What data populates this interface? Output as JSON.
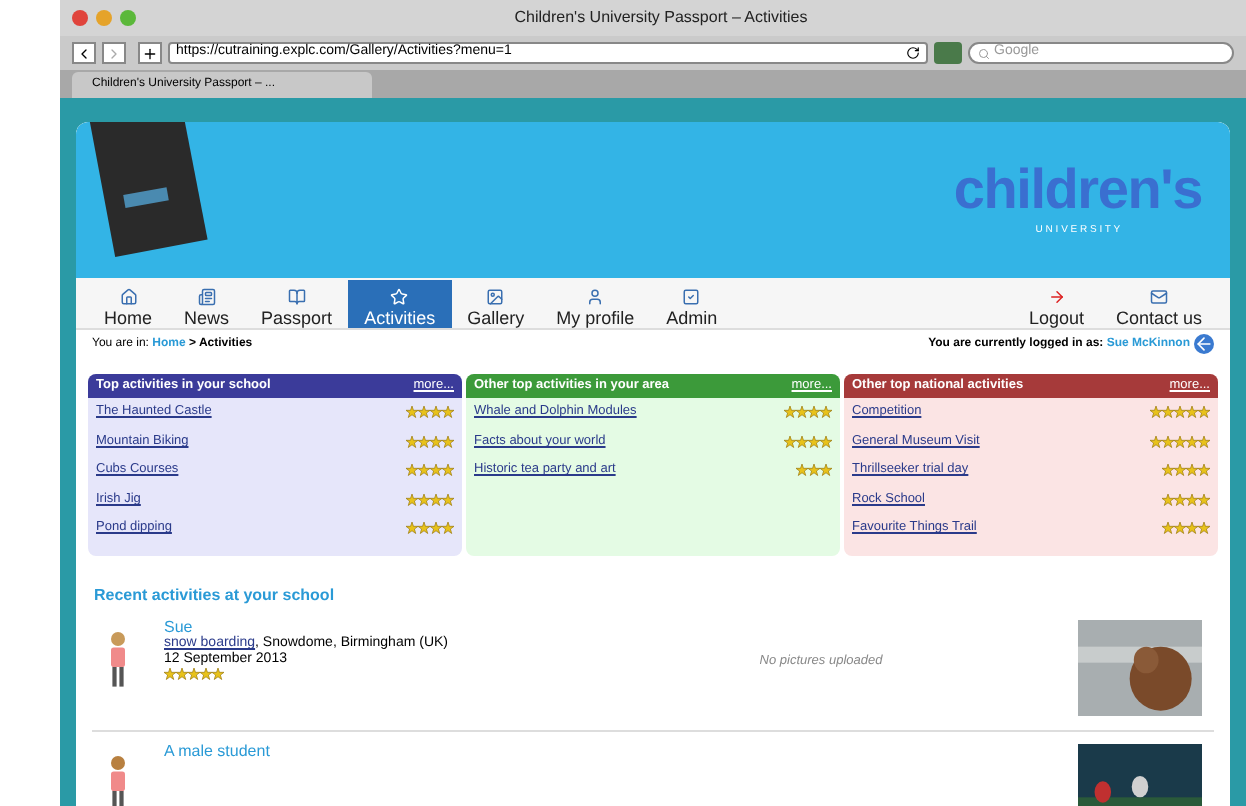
{
  "window": {
    "title": "Children's University Passport – Activities"
  },
  "toolbar": {
    "url": "https://cutraining.explc.com/Gallery/Activities?menu=1",
    "search_placeholder": "Google"
  },
  "tabs": [
    {
      "label": "Children's University Passport – ...",
      "selected": true
    }
  ],
  "logo": {
    "word": "children's",
    "subtitle": "U N I V E R S I T Y"
  },
  "nav": [
    {
      "label": "Home",
      "selected": false
    },
    {
      "label": "News",
      "selected": false
    },
    {
      "label": "Passport",
      "selected": false
    },
    {
      "label": "Activities",
      "selected": true
    },
    {
      "label": "Gallery",
      "selected": false
    },
    {
      "label": "My profile",
      "selected": false
    },
    {
      "label": "Admin",
      "selected": false
    }
  ],
  "nav_right": [
    {
      "label": "Logout",
      "selected": false
    },
    {
      "label": "Contact us",
      "selected": false
    }
  ],
  "breadcrumb": {
    "prefix": "You are in:",
    "home": "Home",
    "separator": ">",
    "current": "Activities"
  },
  "login": {
    "prefix": "You are currently logged in as:",
    "user": "Sue McKinnon"
  },
  "panels": [
    {
      "title": "Top activities in your school",
      "more": "more...",
      "color": "#3b3b9a",
      "items": [
        {
          "name": "The Haunted Castle",
          "stars": 4
        },
        {
          "name": "Mountain Biking",
          "stars": 4
        },
        {
          "name": "Cubs Courses",
          "stars": 4
        },
        {
          "name": "Irish Jig",
          "stars": 4
        },
        {
          "name": "Pond dipping",
          "stars": 4
        }
      ]
    },
    {
      "title": "Other top activities in your area",
      "more": "more...",
      "color": "#3c9a3a",
      "items": [
        {
          "name": "Whale and Dolphin Modules",
          "stars": 4
        },
        {
          "name": "Facts about your world",
          "stars": 4
        },
        {
          "name": "Historic tea party and art",
          "stars": 3
        }
      ]
    },
    {
      "title": "Other top national activities",
      "more": "more...",
      "color": "#a63a3a",
      "items": [
        {
          "name": "Competition",
          "stars": 5
        },
        {
          "name": "General Museum Visit",
          "stars": 5
        },
        {
          "name": "Thrillseeker trial day",
          "stars": 4
        },
        {
          "name": "Rock School",
          "stars": 4
        },
        {
          "name": "Favourite Things Trail",
          "stars": 4
        }
      ]
    }
  ],
  "recent": {
    "heading": "Recent activities at your school",
    "entries": [
      {
        "name": "Sue",
        "activity": "snow boarding",
        "place": ", Snowdome, Birmingham (UK)",
        "date": "12 September 2013",
        "stars": 5,
        "pictures": "No pictures uploaded"
      },
      {
        "name": "A male student"
      }
    ]
  }
}
